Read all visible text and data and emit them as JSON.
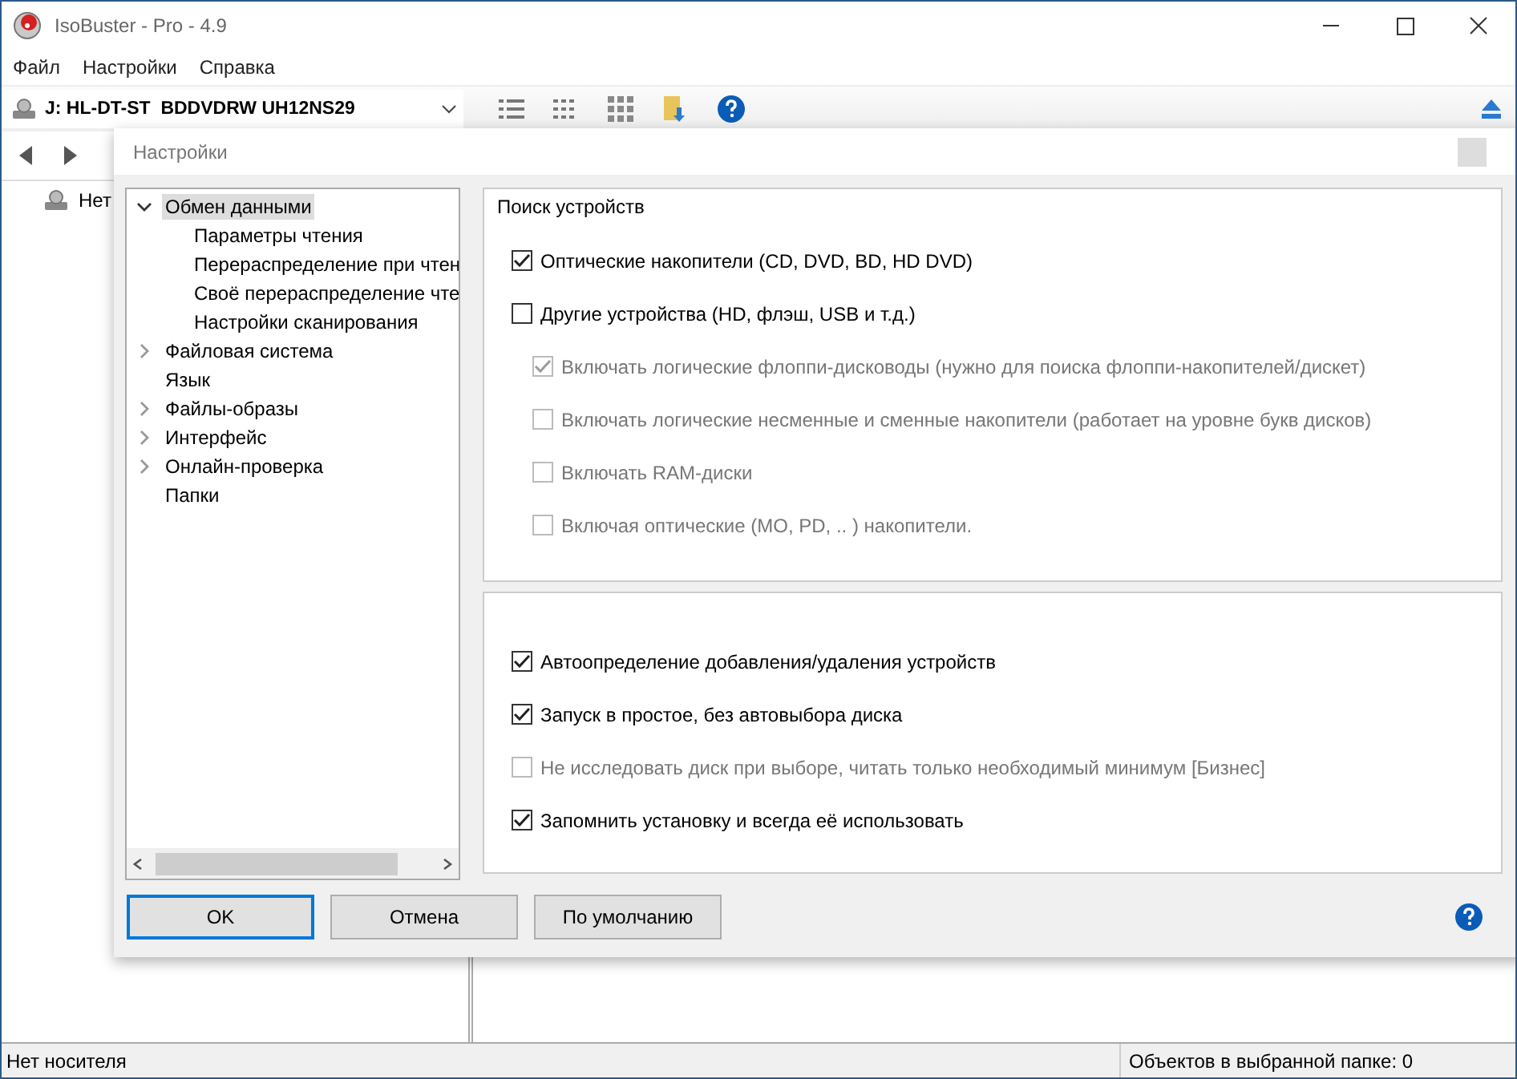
{
  "window": {
    "title": "IsoBuster - Pro - 4.9"
  },
  "menu": [
    "Файл",
    "Настройки",
    "Справка"
  ],
  "drive": {
    "value": "J: HL-DT-ST  BDDVDRW UH12NS29"
  },
  "left_tree": [
    {
      "label": "Нет",
      "selected": false
    }
  ],
  "dialog": {
    "title": "Настройки",
    "tree": [
      {
        "label": "Обмен данными",
        "selected": true,
        "expanded": true,
        "children": [
          {
            "label": "Параметры чтения",
            "selected": false
          },
          {
            "label": "Перераспределение при чтен",
            "selected": false
          },
          {
            "label": "Своё перераспределение чте",
            "selected": false
          },
          {
            "label": "Настройки сканирования",
            "selected": false
          }
        ]
      },
      {
        "label": "Файловая система",
        "selected": false,
        "expanded": false
      },
      {
        "label": "Язык",
        "selected": false
      },
      {
        "label": "Файлы-образы",
        "selected": false,
        "expanded": false
      },
      {
        "label": "Интерфейс",
        "selected": false,
        "expanded": false
      },
      {
        "label": "Онлайн-проверка",
        "selected": false,
        "expanded": false
      },
      {
        "label": "Папки",
        "selected": false
      }
    ],
    "group1": {
      "title": "Поиск устройств",
      "options": [
        {
          "label": "Оптические накопители (CD, DVD, BD, HD DVD)",
          "checked": true,
          "disabled": false,
          "indent": false
        },
        {
          "label": "Другие устройства (HD, флэш, USB и т.д.)",
          "checked": false,
          "disabled": false,
          "indent": false
        },
        {
          "label": "Включать логические флоппи-дисководы (нужно для поиска флоппи-накопителей/дискет)",
          "checked": true,
          "disabled": true,
          "indent": true
        },
        {
          "label": "Включать логические несменные и сменные накопители (работает на уровне букв дисков)",
          "checked": false,
          "disabled": true,
          "indent": true
        },
        {
          "label": "Включать RAM-диски",
          "checked": false,
          "disabled": true,
          "indent": true
        },
        {
          "label": "Включая оптические (MO, PD, .. ) накопители.",
          "checked": false,
          "disabled": true,
          "indent": true
        }
      ]
    },
    "group2": {
      "options": [
        {
          "label": "Автоопределение добавления/удаления устройств",
          "checked": true,
          "disabled": false
        },
        {
          "label": "Запуск в простое, без автовыбора диска",
          "checked": true,
          "disabled": false
        },
        {
          "label": "Не исследовать диск при выборе, читать только необходимый минимум [Бизнес]",
          "checked": false,
          "disabled": true
        },
        {
          "label": "Запомнить установку и всегда её использовать",
          "checked": true,
          "disabled": false
        }
      ]
    },
    "buttons": [
      {
        "label": "OK",
        "selected": true
      },
      {
        "label": "Отмена",
        "selected": false
      },
      {
        "label": "По умолчанию",
        "selected": false
      }
    ]
  },
  "status_bar": [
    "Нет носителя",
    "Объектов в выбранной папке: 0"
  ]
}
